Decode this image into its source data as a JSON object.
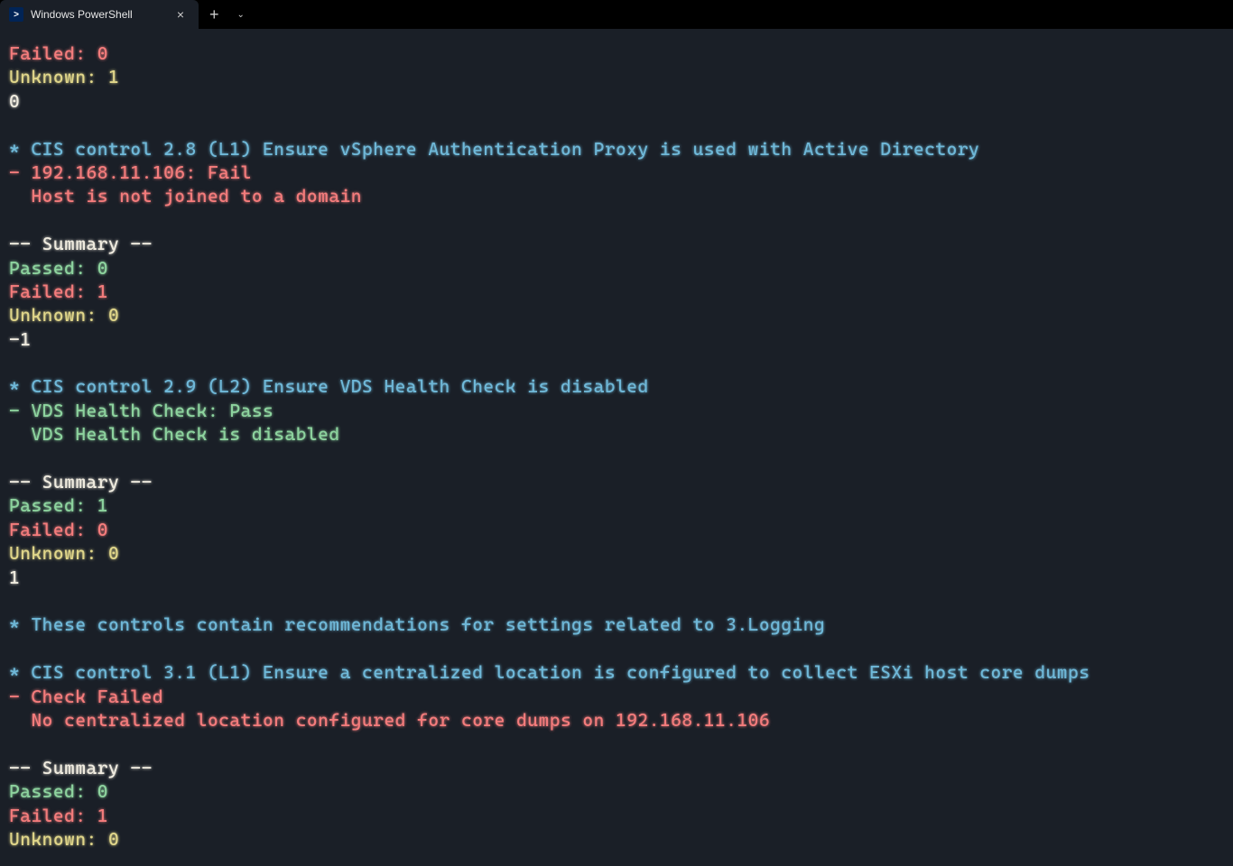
{
  "tab": {
    "title": "Windows PowerShell",
    "icon_glyph": ">"
  },
  "lines": [
    {
      "cls": "red",
      "text": "Failed: 0"
    },
    {
      "cls": "yellow",
      "text": "Unknown: 1"
    },
    {
      "cls": "white",
      "text": "0"
    },
    {
      "cls": "blank",
      "text": ""
    },
    {
      "cls": "cyan",
      "text": "* CIS control 2.8 (L1) Ensure vSphere Authentication Proxy is used with Active Directory"
    },
    {
      "cls": "red",
      "text": "- 192.168.11.106: Fail"
    },
    {
      "cls": "red",
      "text": "  Host is not joined to a domain"
    },
    {
      "cls": "blank",
      "text": ""
    },
    {
      "cls": "white",
      "text": "-- Summary --"
    },
    {
      "cls": "green",
      "text": "Passed: 0"
    },
    {
      "cls": "red",
      "text": "Failed: 1"
    },
    {
      "cls": "yellow",
      "text": "Unknown: 0"
    },
    {
      "cls": "white",
      "text": "-1"
    },
    {
      "cls": "blank",
      "text": ""
    },
    {
      "cls": "cyan",
      "text": "* CIS control 2.9 (L2) Ensure VDS Health Check is disabled"
    },
    {
      "cls": "green",
      "text": "- VDS Health Check: Pass"
    },
    {
      "cls": "green",
      "text": "  VDS Health Check is disabled"
    },
    {
      "cls": "blank",
      "text": ""
    },
    {
      "cls": "white",
      "text": "-- Summary --"
    },
    {
      "cls": "green",
      "text": "Passed: 1"
    },
    {
      "cls": "red",
      "text": "Failed: 0"
    },
    {
      "cls": "yellow",
      "text": "Unknown: 0"
    },
    {
      "cls": "white",
      "text": "1"
    },
    {
      "cls": "blank",
      "text": ""
    },
    {
      "cls": "cyan",
      "text": "* These controls contain recommendations for settings related to 3.Logging"
    },
    {
      "cls": "blank",
      "text": ""
    },
    {
      "cls": "cyan",
      "text": "* CIS control 3.1 (L1) Ensure a centralized location is configured to collect ESXi host core dumps"
    },
    {
      "cls": "red",
      "text": "- Check Failed"
    },
    {
      "cls": "red",
      "text": "  No centralized location configured for core dumps on 192.168.11.106"
    },
    {
      "cls": "blank",
      "text": ""
    },
    {
      "cls": "white",
      "text": "-- Summary --"
    },
    {
      "cls": "green",
      "text": "Passed: 0"
    },
    {
      "cls": "red",
      "text": "Failed: 1"
    },
    {
      "cls": "yellow",
      "text": "Unknown: 0"
    }
  ]
}
